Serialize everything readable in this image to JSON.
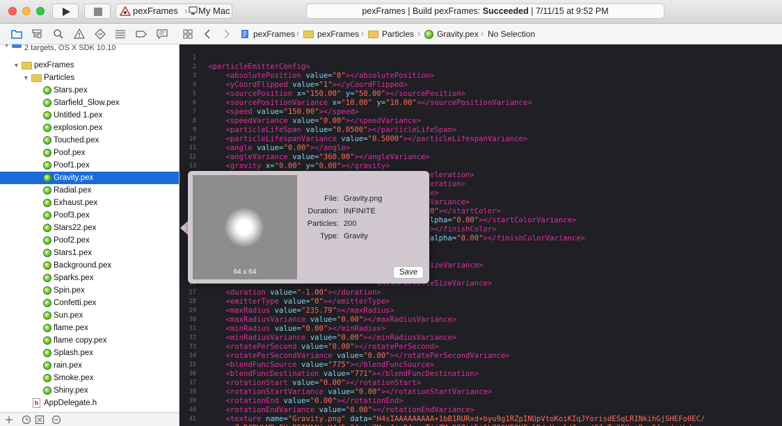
{
  "toolbar": {
    "scheme_name": "pexFrames",
    "scheme_separator": "›",
    "destination": "My Mac",
    "status_prefix": "pexFrames  |  Build pexFrames: ",
    "status_result": "Succeeded",
    "status_time": "  |  7/11/15 at 9:52 PM"
  },
  "navigator": {
    "project_name": "pexFrames",
    "project_subtitle": "2 targets, OS X SDK 10.10",
    "group": "pexFrames",
    "subgroup": "Particles",
    "files": [
      "Stars.pex",
      "Starfield_Slow.pex",
      "Untitled 1.pex",
      "explosion.pex",
      "Touched.pex",
      "Poof.pex",
      "Poof1.pex",
      "Gravity.pex",
      "Radial.pex",
      "Exhaust.pex",
      "Poof3.pex",
      "Stars22.pex",
      "Poof2.pex",
      "Stars1.pex",
      "Background.pex",
      "Sparks.pex",
      "Spin.pex",
      "Confetti.pex",
      "Sun.pex",
      "flame.pex",
      "flame copy.pex",
      "Splash.pex",
      "rain.pex",
      "Smoke.pex",
      "Shiny.pex"
    ],
    "selected_file": "Gravity.pex",
    "extra_file": "AppDelegate.h",
    "header_glyph": "h"
  },
  "jumpbar": {
    "crumbs": [
      "pexFrames",
      "pexFrames",
      "Particles",
      "Gravity.pex",
      "No Selection"
    ],
    "sep": "›"
  },
  "popover": {
    "preview_size": "64 x 64",
    "file_label": "File:",
    "file_value": "Gravity.png",
    "duration_label": "Duration:",
    "duration_value": "INFINITE",
    "particles_label": "Particles:",
    "particles_value": "200",
    "type_label": "Type:",
    "type_value": "Gravity",
    "save_label": "Save"
  },
  "editor": {
    "lines": [
      {
        "n": "1",
        "segs": []
      },
      {
        "n": "2",
        "segs": [
          [
            "t",
            "<particleEmitterConfig>"
          ]
        ]
      },
      {
        "n": "3",
        "segs": [
          [
            "t",
            "    <absolutePosition "
          ],
          [
            "an",
            "value="
          ],
          [
            "v",
            "\"0\""
          ],
          [
            "t",
            "></absolutePosition>"
          ]
        ]
      },
      {
        "n": "4",
        "segs": [
          [
            "t",
            "    <yCoordFlipped "
          ],
          [
            "an",
            "value="
          ],
          [
            "v",
            "\"1\""
          ],
          [
            "t",
            "></yCoordFlipped>"
          ]
        ]
      },
      {
        "n": "5",
        "segs": [
          [
            "t",
            "    <sourcePosition "
          ],
          [
            "an",
            "x="
          ],
          [
            "v",
            "\"150.00\""
          ],
          [
            "an",
            " y="
          ],
          [
            "v",
            "\"50.00\""
          ],
          [
            "t",
            "></sourcePosition>"
          ]
        ]
      },
      {
        "n": "6",
        "segs": [
          [
            "t",
            "    <sourcePositionVariance "
          ],
          [
            "an",
            "x="
          ],
          [
            "v",
            "\"10.00\""
          ],
          [
            "an",
            " y="
          ],
          [
            "v",
            "\"10.00\""
          ],
          [
            "t",
            "></sourcePositionVariance>"
          ]
        ]
      },
      {
        "n": "7",
        "segs": [
          [
            "t",
            "    <speed "
          ],
          [
            "an",
            "value="
          ],
          [
            "v",
            "\"150.00\""
          ],
          [
            "t",
            "></speed>"
          ]
        ]
      },
      {
        "n": "8",
        "segs": [
          [
            "t",
            "    <speedVariance "
          ],
          [
            "an",
            "value="
          ],
          [
            "v",
            "\"0.00\""
          ],
          [
            "t",
            "></speedVariance>"
          ]
        ]
      },
      {
        "n": "9",
        "segs": [
          [
            "t",
            "    <particleLifeSpan "
          ],
          [
            "an",
            "value="
          ],
          [
            "v",
            "\"0.0500\""
          ],
          [
            "t",
            "></particleLifeSpan>"
          ]
        ]
      },
      {
        "n": "10",
        "segs": [
          [
            "t",
            "    <particleLifespanVariance "
          ],
          [
            "an",
            "value="
          ],
          [
            "v",
            "\"0.5000\""
          ],
          [
            "t",
            "></particleLifespanVariance>"
          ]
        ]
      },
      {
        "n": "11",
        "segs": [
          [
            "t",
            "    <angle "
          ],
          [
            "an",
            "value="
          ],
          [
            "v",
            "\"0.00\""
          ],
          [
            "t",
            "></angle>"
          ]
        ]
      },
      {
        "n": "12",
        "segs": [
          [
            "t",
            "    <angleVariance "
          ],
          [
            "an",
            "value="
          ],
          [
            "v",
            "\"360.00\""
          ],
          [
            "t",
            "></angleVariance>"
          ]
        ]
      },
      {
        "n": "13",
        "segs": [
          [
            "t",
            "    <gravity "
          ],
          [
            "an",
            "x="
          ],
          [
            "v",
            "\"0.00\""
          ],
          [
            "an",
            " y="
          ],
          [
            "v",
            "\"0.00\""
          ],
          [
            "t",
            "></gravity>"
          ]
        ]
      },
      {
        "n": "14",
        "segs": [
          [
            "t",
            "    <radialAcceleration "
          ],
          [
            "an",
            "value="
          ],
          [
            "v",
            "\"100.00\""
          ],
          [
            "t",
            "></radialAcceleration>"
          ]
        ]
      },
      {
        "n": "15",
        "segs": [
          [
            "t",
            "                                        ntialAcceleration>"
          ]
        ]
      },
      {
        "n": "16",
        "segs": [
          [
            "t",
            "                                        celVariance>"
          ]
        ]
      },
      {
        "n": "17",
        "segs": [
          [
            "t",
            "                                        ntialAccelVariance>"
          ]
        ]
      },
      {
        "n": "18",
        "segs": [
          [
            "v",
            "                                     0\""
          ],
          [
            "an",
            " alpha="
          ],
          [
            "v",
            "\"0.00\""
          ],
          [
            "t",
            "></startColor>"
          ]
        ]
      },
      {
        "n": "19",
        "segs": [
          [
            "an",
            "                                      lue="
          ],
          [
            "v",
            "\"0.17\""
          ],
          [
            "an",
            " alpha="
          ],
          [
            "v",
            "\"0.00\""
          ],
          [
            "t",
            "></startColorVariance>"
          ]
        ]
      },
      {
        "n": "20",
        "segs": [
          [
            "an",
            "                                      alpha="
          ],
          [
            "v",
            "\"0.00\""
          ],
          [
            "t",
            "></finishColor>"
          ]
        ]
      },
      {
        "n": "21",
        "segs": [
          [
            "an",
            "                                      blue="
          ],
          [
            "v",
            "\"0.00\""
          ],
          [
            "an",
            " alpha="
          ],
          [
            "v",
            "\"0.00\""
          ],
          [
            "t",
            "></finishColorVariance>"
          ]
        ]
      },
      {
        "n": "22",
        "segs": []
      },
      {
        "n": "23",
        "segs": [
          [
            "t",
            "                                      rticleSize>"
          ]
        ]
      },
      {
        "n": "24",
        "segs": [
          [
            "t",
            "                                      artParticleSizeVariance>"
          ]
        ]
      },
      {
        "n": "25",
        "segs": [
          [
            "t",
            "                                      rticleSize>"
          ]
        ]
      },
      {
        "n": "26",
        "segs": [
          [
            "t",
            "                                      inishParticleSizeVariance>"
          ]
        ]
      },
      {
        "n": "27",
        "segs": [
          [
            "t",
            "    <duration "
          ],
          [
            "an",
            "value="
          ],
          [
            "v",
            "\"-1.00\""
          ],
          [
            "t",
            "></duration>"
          ]
        ]
      },
      {
        "n": "28",
        "segs": [
          [
            "t",
            "    <emitterType "
          ],
          [
            "an",
            "value="
          ],
          [
            "v",
            "\"0\""
          ],
          [
            "t",
            "></emitterType>"
          ]
        ]
      },
      {
        "n": "29",
        "segs": [
          [
            "t",
            "    <maxRadius "
          ],
          [
            "an",
            "value="
          ],
          [
            "v",
            "\"235.79\""
          ],
          [
            "t",
            "></maxRadius>"
          ]
        ]
      },
      {
        "n": "30",
        "segs": [
          [
            "t",
            "    <maxRadiusVariance "
          ],
          [
            "an",
            "value="
          ],
          [
            "v",
            "\"0.00\""
          ],
          [
            "t",
            "></maxRadiusVariance>"
          ]
        ]
      },
      {
        "n": "31",
        "segs": [
          [
            "t",
            "    <minRadius "
          ],
          [
            "an",
            "value="
          ],
          [
            "v",
            "\"0.00\""
          ],
          [
            "t",
            "></minRadius>"
          ]
        ]
      },
      {
        "n": "32",
        "segs": [
          [
            "t",
            "    <minRadiusVariance "
          ],
          [
            "an",
            "value="
          ],
          [
            "v",
            "\"0.00\""
          ],
          [
            "t",
            "></minRadiusVariance>"
          ]
        ]
      },
      {
        "n": "33",
        "segs": [
          [
            "t",
            "    <rotatePerSecond "
          ],
          [
            "an",
            "value="
          ],
          [
            "v",
            "\"0.00\""
          ],
          [
            "t",
            "></rotatePerSecond>"
          ]
        ]
      },
      {
        "n": "34",
        "segs": [
          [
            "t",
            "    <rotatePerSecondVariance "
          ],
          [
            "an",
            "value="
          ],
          [
            "v",
            "\"0.00\""
          ],
          [
            "t",
            "></rotatePerSecondVariance>"
          ]
        ]
      },
      {
        "n": "35",
        "segs": [
          [
            "t",
            "    <blendFuncSource "
          ],
          [
            "an",
            "value="
          ],
          [
            "v",
            "\"775\""
          ],
          [
            "t",
            "></blendFuncSource>"
          ]
        ]
      },
      {
        "n": "36",
        "segs": [
          [
            "t",
            "    <blendFuncDestination "
          ],
          [
            "an",
            "value="
          ],
          [
            "v",
            "\"771\""
          ],
          [
            "t",
            "></blendFuncDestination>"
          ]
        ]
      },
      {
        "n": "37",
        "segs": [
          [
            "t",
            "    <rotationStart "
          ],
          [
            "an",
            "value="
          ],
          [
            "v",
            "\"0.00\""
          ],
          [
            "t",
            "></rotationStart>"
          ]
        ]
      },
      {
        "n": "38",
        "segs": [
          [
            "t",
            "    <rotationStartVariance "
          ],
          [
            "an",
            "value="
          ],
          [
            "v",
            "\"0.00\""
          ],
          [
            "t",
            "></rotationStartVariance>"
          ]
        ]
      },
      {
        "n": "39",
        "segs": [
          [
            "t",
            "    <rotationEnd "
          ],
          [
            "an",
            "value="
          ],
          [
            "v",
            "\"0.00\""
          ],
          [
            "t",
            "></rotationEnd>"
          ]
        ]
      },
      {
        "n": "40",
        "segs": [
          [
            "t",
            "    <rotationEndVariance "
          ],
          [
            "an",
            "value="
          ],
          [
            "v",
            "\"0.00\""
          ],
          [
            "t",
            "></rotationEndVariance>"
          ]
        ]
      },
      {
        "n": "41",
        "segs": [
          [
            "t",
            "    <texture "
          ],
          [
            "an",
            "name="
          ],
          [
            "v",
            "\"Gravity.png\""
          ],
          [
            "an",
            " data="
          ],
          [
            "v",
            "\"H4sIAAAAAAAAA+1bB1RURxd+byu9g1RZpINUpVtoKoiKIqJYorisdESqLRINkihGjSHEFo0EC/"
          ]
        ]
      },
      {
        "n": "",
        "segs": [
          [
            "v",
            "      ZoRCRWLMRoFHuPEIMlNizY4/5z3fvic7MrmJic84vr+Tjj7My997tt5i1L796UE0UFqlD/wUsqldJvgv/CJrTr35KrjBunGfyn/nib/"
          ]
        ]
      }
    ]
  },
  "colors": {
    "tag": "#e22ea3",
    "attribute": "#8bd0f0",
    "string": "#ff6e5e",
    "selection": "#1b6ad8",
    "editor_background": "#1f1f24"
  }
}
